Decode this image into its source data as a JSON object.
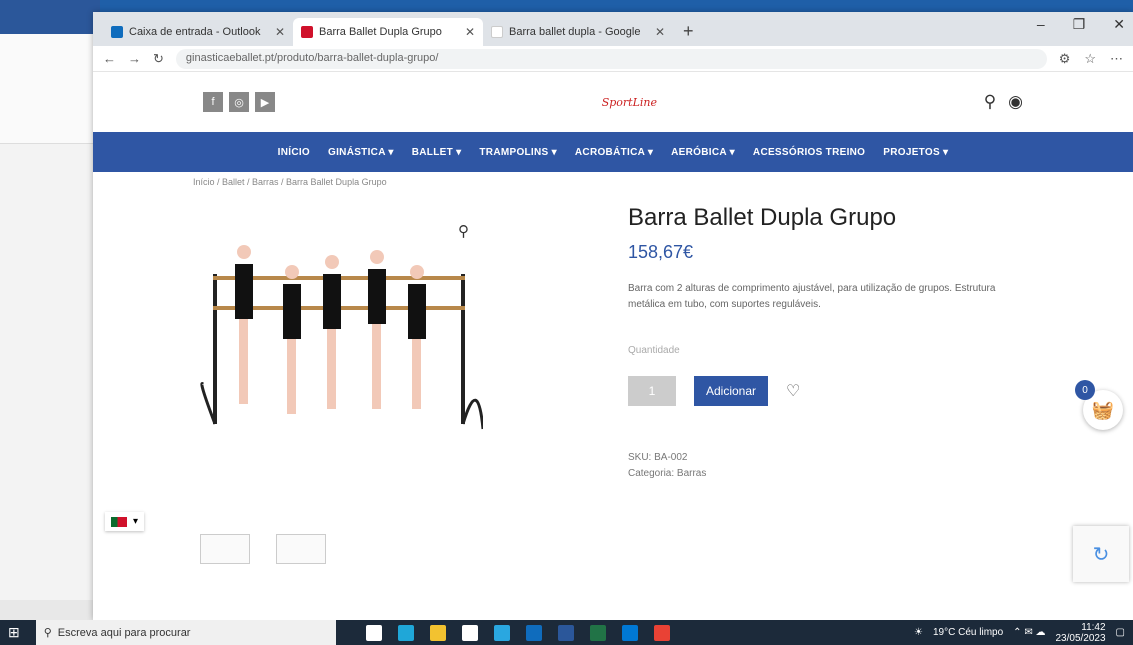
{
  "browser": {
    "tabs": [
      {
        "title": "Caixa de entrada - Outlook",
        "favicon_color": "#0f6cbd",
        "active": false
      },
      {
        "title": "Barra Ballet Dupla Grupo",
        "favicon_color": "#d0112b",
        "active": true
      },
      {
        "title": "Barra ballet dupla - Google",
        "favicon_color": "#ffffff",
        "active": false
      }
    ],
    "new_tab": "+",
    "url": "ginasticaeballet.pt/produto/barra-ballet-dupla-grupo/",
    "window_controls": [
      "–",
      "❐",
      "✕"
    ]
  },
  "site": {
    "socials": [
      "f",
      "◎",
      "▶"
    ],
    "logo": "SportLine",
    "nav": [
      "INÍCIO",
      "GINÁSTICA ▾",
      "BALLET ▾",
      "TRAMPOLINS ▾",
      "ACROBÁTICA ▾",
      "AERÓBICA ▾",
      "ACESSÓRIOS TREINO",
      "PROJETOS ▾"
    ],
    "breadcrumb": "Início / Ballet / Barras / Barra Ballet Dupla Grupo",
    "product": {
      "title": "Barra Ballet Dupla Grupo",
      "price": "158,67€",
      "description": "Barra com 2 alturas de comprimento ajustável, para utilização de grupos. Estrutura metálica em tubo, com suportes reguláveis.",
      "stock_label": "Quantidade",
      "qty": "1",
      "add_button": "Adicionar",
      "sku": "SKU: BA-002",
      "category": "Categoria: Barras"
    },
    "cart_count": "0",
    "language_flag": "PT"
  },
  "taskbar": {
    "search_placeholder": "Escreva aqui para procurar",
    "weather": "19°C  Céu limpo",
    "time": "11:42",
    "date": "23/05/2023"
  },
  "colors": {
    "brand": "#2f56a4",
    "accent": "#c22222"
  }
}
